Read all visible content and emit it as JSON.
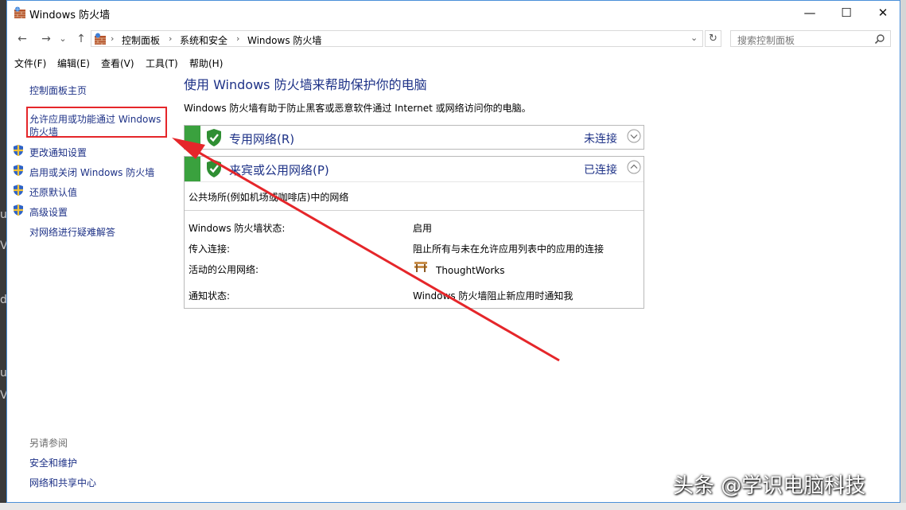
{
  "window": {
    "title": "Windows 防火墙",
    "minimize_glyph": "—",
    "maximize_glyph": "☐",
    "close_glyph": "✕"
  },
  "nav": {
    "back": "←",
    "forward": "→",
    "history": "⌄",
    "up": "↑"
  },
  "address": {
    "breadcrumbs": [
      "控制面板",
      "系统和安全",
      "Windows 防火墙"
    ],
    "separator": "›",
    "dropdown_glyph": "⌄",
    "refresh_glyph": "↻"
  },
  "search": {
    "placeholder": "搜索控制面板"
  },
  "menu": [
    "文件(F)",
    "编辑(E)",
    "查看(V)",
    "工具(T)",
    "帮助(H)"
  ],
  "sidebar": {
    "home": "控制面板主页",
    "allow_line1": "允许应用或功能通过 Windows",
    "allow_line2": "防火墙",
    "notify": "更改通知设置",
    "toggle": "启用或关闭 Windows 防火墙",
    "restore": "还原默认值",
    "advanced": "高级设置",
    "troubleshoot": "对网络进行疑难解答",
    "see_also": "另请参阅",
    "security": "安全和维护",
    "network_center": "网络和共享中心"
  },
  "main": {
    "title": "使用 Windows 防火墙来帮助保护你的电脑",
    "description": "Windows 防火墙有助于防止黑客或恶意软件通过 Internet 或网络访问你的电脑。",
    "private": {
      "name": "专用网络(R)",
      "status": "未连接"
    },
    "public": {
      "name": "来宾或公用网络(P)",
      "status": "已连接",
      "subtitle": "公共场所(例如机场或咖啡店)中的网络",
      "rows": [
        {
          "label": "Windows 防火墙状态:",
          "value": "启用"
        },
        {
          "label": "传入连接:",
          "value": "阻止所有与未在允许应用列表中的应用的连接"
        },
        {
          "label": "活动的公用网络:",
          "value": "ThoughtWorks"
        },
        {
          "label": "通知状态:",
          "value": "Windows 防火墙阻止新应用时通知我"
        }
      ]
    }
  },
  "overlay": {
    "watermark": "头条 @学识电脑科技"
  },
  "colors": {
    "link": "#1e3287",
    "shield_green": "#3aa13e",
    "highlight_red": "#e5262a"
  }
}
